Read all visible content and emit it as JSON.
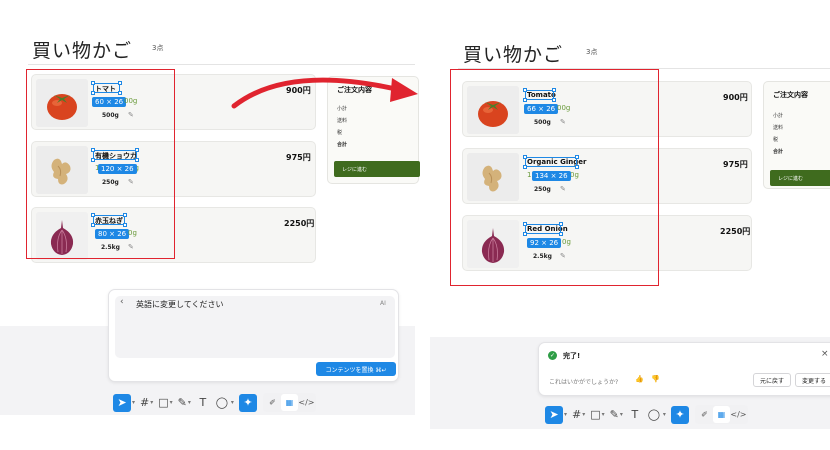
{
  "colors": {
    "accent": "#1e88e5",
    "selection_frame": "#e0242f",
    "arrow": "#e0242f",
    "checkout": "#3f6b1e",
    "success": "#2e9d46"
  },
  "before": {
    "title": "買い物かご",
    "count": "3点",
    "items": [
      {
        "name": "トマト",
        "subtitle_tail": "00g",
        "dimension": "60 × 26",
        "qty": "500g",
        "price": "900円",
        "image": "tomato"
      },
      {
        "name": "有機ショウガ",
        "subtitle_head": "1",
        "subtitle_tail": "0g",
        "dimension": "120 × 26",
        "qty": "250g",
        "price": "975円",
        "image": "ginger"
      },
      {
        "name": "赤玉ねぎ",
        "subtitle_tail": "0g",
        "dimension": "80 × 26",
        "qty": "2.5kg",
        "price": "2250円",
        "image": "red-onion"
      }
    ],
    "summary": {
      "title": "ご注文内容",
      "rows": [
        "小計",
        "送料",
        "税",
        "合計"
      ],
      "checkout": "レジに進む"
    },
    "prompt": {
      "back": "‹",
      "text": "英語に変更してください",
      "ai": "AI",
      "replace_button": "コンテンツを置換 ⌘↵"
    }
  },
  "after": {
    "title": "買い物かご",
    "count": "3点",
    "items": [
      {
        "name": "Tomato",
        "subtitle_tail": "00g",
        "dimension": "66 × 26",
        "qty": "500g",
        "price": "900円",
        "image": "tomato"
      },
      {
        "name": "Organic Ginger",
        "subtitle_head": "1",
        "subtitle_tail": "0g",
        "dimension": "134 × 26",
        "qty": "250g",
        "price": "975円",
        "image": "ginger"
      },
      {
        "name": "Red Onion",
        "subtitle_tail": "0g",
        "dimension": "92 × 26",
        "qty": "2.5kg",
        "price": "2250円",
        "image": "red-onion"
      }
    ],
    "summary": {
      "title": "ご注文内容",
      "rows": [
        "小計",
        "送料",
        "税",
        "合計"
      ],
      "checkout": "レジに進む"
    },
    "done": {
      "label": "完了!",
      "close": "×",
      "feedback": "これはいかがでしょうか?",
      "thumb_up": "👍",
      "thumb_down": "👎",
      "revert_button": "元に戻す",
      "keep_button": "変更する"
    }
  },
  "toolbar": {
    "tools": [
      {
        "name": "select-tool",
        "icon": "pointer-icon",
        "glyph": "➤"
      },
      {
        "name": "frame-tool",
        "icon": "frame-icon",
        "glyph": "#"
      },
      {
        "name": "shape-tool",
        "icon": "rectangle-icon",
        "glyph": "□"
      },
      {
        "name": "pen-tool",
        "icon": "pen-icon",
        "glyph": "✎"
      },
      {
        "name": "text-tool",
        "icon": "text-icon",
        "glyph": "T"
      },
      {
        "name": "comment-tool",
        "icon": "comment-icon",
        "glyph": "◯"
      },
      {
        "name": "ai-tool",
        "icon": "sparkle-icon",
        "glyph": "✦"
      }
    ],
    "modes": [
      {
        "name": "draw-mode",
        "icon": "pencil-mode-icon",
        "glyph": "✐"
      },
      {
        "name": "design-mode",
        "icon": "design-mode-icon",
        "glyph": "▦"
      },
      {
        "name": "dev-mode",
        "icon": "code-icon",
        "glyph": "</>"
      }
    ]
  }
}
